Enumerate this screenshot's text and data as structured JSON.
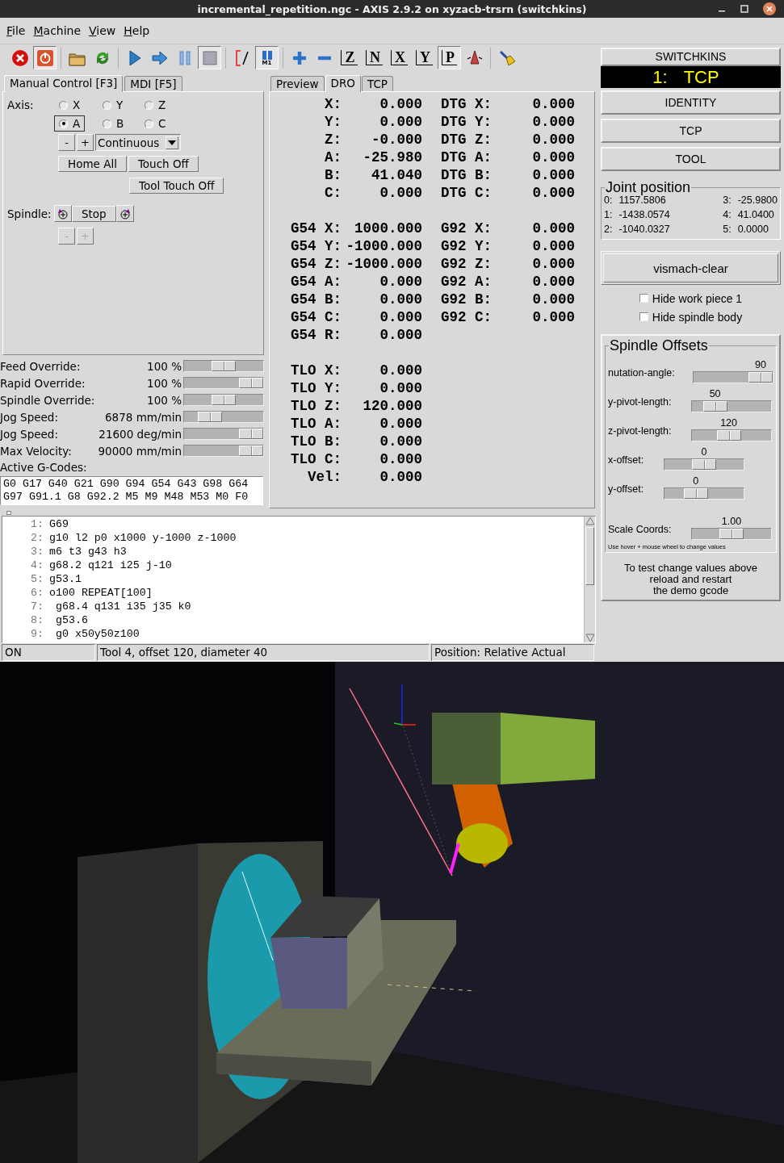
{
  "window": {
    "title": "incremental_repetition.ngc - AXIS 2.9.2 on xyzacb-trsrn (switchkins)"
  },
  "menu": [
    "File",
    "Machine",
    "View",
    "Help"
  ],
  "toolbar": {
    "groups": [
      {
        "buttons": [
          {
            "kind": "estop",
            "pressed": false
          },
          {
            "kind": "power",
            "pressed": true
          }
        ]
      },
      {
        "buttons": [
          {
            "kind": "open",
            "pressed": false
          },
          {
            "kind": "reload",
            "pressed": false
          }
        ]
      },
      {
        "buttons": [
          {
            "kind": "run",
            "pressed": false
          },
          {
            "kind": "step",
            "pressed": false
          },
          {
            "kind": "pause",
            "pressed": false
          },
          {
            "kind": "stop",
            "pressed": true
          }
        ]
      },
      {
        "buttons": [
          {
            "kind": "block-delete",
            "pressed": false
          },
          {
            "kind": "optional-stop",
            "label": "M1",
            "pressed": true
          }
        ]
      },
      {
        "buttons": [
          {
            "kind": "zoom-in",
            "pressed": false
          },
          {
            "kind": "zoom-out",
            "pressed": false
          },
          {
            "kind": "view",
            "label": "Z",
            "pressed": false
          },
          {
            "kind": "view",
            "label": "N",
            "pressed": false
          },
          {
            "kind": "view",
            "label": "X",
            "pressed": false
          },
          {
            "kind": "view",
            "label": "Y",
            "pressed": false
          },
          {
            "kind": "view",
            "label": "P",
            "pressed": true
          },
          {
            "kind": "clear-cone",
            "pressed": false
          }
        ]
      },
      {
        "buttons": [
          {
            "kind": "brush",
            "pressed": false
          }
        ]
      }
    ]
  },
  "left_tabs": [
    {
      "label": "Manual Control [F3]",
      "selected": true
    },
    {
      "label": "MDI [F5]",
      "selected": false
    }
  ],
  "manual": {
    "axis_label": "Axis:",
    "axes": [
      {
        "label": "X",
        "selected": false
      },
      {
        "label": "Y",
        "selected": false
      },
      {
        "label": "Z",
        "selected": false
      },
      {
        "label": "A",
        "selected": true
      },
      {
        "label": "B",
        "selected": false
      },
      {
        "label": "C",
        "selected": false
      }
    ],
    "jog_minus": "-",
    "jog_plus": "+",
    "jog_mode": "Continuous",
    "buttons": [
      "Home All",
      "Touch Off",
      "Tool Touch Off"
    ],
    "spindle": {
      "label": "Spindle:",
      "stop": "Stop",
      "minus": {
        "label": "-",
        "disabled": true
      },
      "plus": {
        "label": "+",
        "disabled": true
      }
    }
  },
  "overrides": [
    {
      "label": "Feed Override:",
      "value": "100 %",
      "level": 0.5
    },
    {
      "label": "Rapid Override:",
      "value": "100 %",
      "level": 1
    },
    {
      "label": "Spindle Override:",
      "value": "100 %",
      "level": 0.5
    },
    {
      "label": "Jog Speed:",
      "value": "6878 mm/min",
      "level": 0.25
    },
    {
      "label": "Jog Speed:",
      "value": "21600 deg/min",
      "level": 1
    },
    {
      "label": "Max Velocity:",
      "value": "90000 mm/min",
      "level": 1
    }
  ],
  "active_gcodes": {
    "label": "Active G-Codes:",
    "lines": [
      "G0 G17 G40 G21 G90 G94 G54 G43 G98 G64",
      "G97 G91.1 G8 G92.2 M5 M9 M48 M53 M0 F0"
    ]
  },
  "center_tabs": [
    {
      "label": "Preview",
      "selected": false
    },
    {
      "label": "DRO",
      "selected": true
    },
    {
      "label": "TCP",
      "selected": false
    }
  ],
  "dro": {
    "groups": [
      {
        "rows": [
          {
            "label": "X:",
            "value": "0.000",
            "right_label": "DTG X:",
            "right_value": "0.000"
          },
          {
            "label": "Y:",
            "value": "0.000",
            "right_label": "DTG Y:",
            "right_value": "0.000"
          },
          {
            "label": "Z:",
            "value": "-0.000",
            "right_label": "DTG Z:",
            "right_value": "0.000"
          },
          {
            "label": "A:",
            "value": "-25.980",
            "right_label": "DTG A:",
            "right_value": "0.000"
          },
          {
            "label": "B:",
            "value": "41.040",
            "right_label": "DTG B:",
            "right_value": "0.000"
          },
          {
            "label": "C:",
            "value": "0.000",
            "right_label": "DTG C:",
            "right_value": "0.000"
          }
        ]
      },
      {
        "rows": [
          {
            "label": "G54 X:",
            "value": "1000.000",
            "right_label": "G92 X:",
            "right_value": "0.000"
          },
          {
            "label": "G54 Y:",
            "value": "-1000.000",
            "right_label": "G92 Y:",
            "right_value": "0.000"
          },
          {
            "label": "G54 Z:",
            "value": "-1000.000",
            "right_label": "G92 Z:",
            "right_value": "0.000"
          },
          {
            "label": "G54 A:",
            "value": "0.000",
            "right_label": "G92 A:",
            "right_value": "0.000"
          },
          {
            "label": "G54 B:",
            "value": "0.000",
            "right_label": "G92 B:",
            "right_value": "0.000"
          },
          {
            "label": "G54 C:",
            "value": "0.000",
            "right_label": "G92 C:",
            "right_value": "0.000"
          },
          {
            "label": "G54 R:",
            "value": "0.000"
          }
        ]
      },
      {
        "rows": [
          {
            "label": "TLO X:",
            "value": "0.000"
          },
          {
            "label": "TLO Y:",
            "value": "0.000"
          },
          {
            "label": "TLO Z:",
            "value": "120.000"
          },
          {
            "label": "TLO A:",
            "value": "0.000"
          },
          {
            "label": "TLO B:",
            "value": "0.000"
          },
          {
            "label": "TLO C:",
            "value": "0.000"
          },
          {
            "label": "Vel:",
            "value": "0.000"
          }
        ]
      }
    ]
  },
  "program": {
    "lines": [
      {
        "number": "1:",
        "text": "G69"
      },
      {
        "number": "2:",
        "text": "g10 l2 p0 x1000 y-1000 z-1000"
      },
      {
        "number": "3:",
        "text": "m6 t3 g43 h3"
      },
      {
        "number": "4:",
        "text": "g68.2 q121 i25 j-10"
      },
      {
        "number": "5:",
        "text": "g53.1"
      },
      {
        "number": "6:",
        "text": "o100 REPEAT[100]"
      },
      {
        "number": "7:",
        "text": " g68.4 q131 i35 j35 k0"
      },
      {
        "number": "8:",
        "text": " g53.6"
      },
      {
        "number": "9:",
        "text": " g0 x50y50z100"
      }
    ]
  },
  "status_bar": [
    "ON",
    "Tool 4, offset 120, diameter 40",
    "Position: Relative Actual"
  ],
  "right_panel": {
    "switchkins": {
      "title": "SWITCHKINS",
      "number": "1:",
      "mode": "TCP"
    },
    "kins_buttons": [
      "IDENTITY",
      "TCP",
      "TOOL"
    ],
    "joint_position": {
      "title": "Joint position",
      "joints": [
        {
          "label": "0:",
          "value": "1157.5806"
        },
        {
          "label": "1:",
          "value": "-1438.0574"
        },
        {
          "label": "2:",
          "value": "-1040.0327"
        },
        {
          "label": "3:",
          "value": "-25.9800"
        },
        {
          "label": "4:",
          "value": "41.0400"
        },
        {
          "label": "5:",
          "value": "0.0000"
        }
      ]
    },
    "vismach_button": "vismach-clear",
    "checkboxes": [
      {
        "label": "Hide work piece 1",
        "checked": false
      },
      {
        "label": "Hide spindle body",
        "checked": false
      }
    ],
    "spindle_offsets": {
      "title": "Spindle Offsets",
      "sliders": [
        {
          "label": "nutation-angle:",
          "value": "90",
          "level": 1
        },
        {
          "label": "y-pivot-length:",
          "value": "50",
          "level": 0.2
        },
        {
          "label": "z-pivot-length:",
          "value": "120",
          "level": 0.45
        },
        {
          "label": "x-offset:",
          "value": "0",
          "level": 0.5
        },
        {
          "label": "y-offset:",
          "value": "0",
          "level": 0.35
        },
        {
          "label": "Scale Coords:",
          "value": "1.00",
          "level": 0.5
        }
      ],
      "hint": "Use hover + mouse wheel to change values"
    },
    "note": "To test change values above\nreload and restart\nthe demo gcode"
  }
}
